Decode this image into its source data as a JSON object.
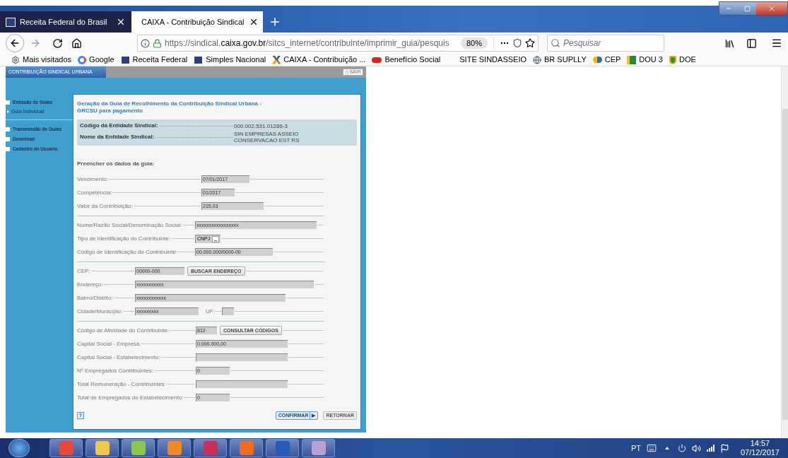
{
  "browser": {
    "tabs": [
      {
        "label": "Receita Federal do Brasil",
        "selected": false
      },
      {
        "label": "CAIXA - Contribuição Sindical",
        "selected": true
      }
    ],
    "address": "https://sindical.**caixa.gov.br**/sitcs_internet/contribuinte/imprimir_guia/pesquis",
    "zoom": "80%",
    "search": {
      "placeholder": "Pesquisar"
    },
    "bookmarks": [
      {
        "label": "Mais visitados",
        "kind": "gear"
      },
      {
        "label": "Google",
        "kind": "google"
      },
      {
        "label": "Receita Federal",
        "kind": "receita"
      },
      {
        "label": "Simples Nacional",
        "kind": "receita"
      },
      {
        "label": "CAIXA - Contribuição ...",
        "kind": "caixa"
      },
      {
        "label": "Benefício Social",
        "kind": "inss"
      },
      {
        "label": "SITE SINDASSEIO",
        "kind": "none"
      },
      {
        "label": "BR SUPLLY",
        "kind": "globe"
      },
      {
        "label": "CEP",
        "kind": "cep"
      },
      {
        "label": "DOU 3",
        "kind": "dou"
      },
      {
        "label": "DOE",
        "kind": "doe"
      }
    ]
  },
  "site": {
    "header_tab": "CONTRIBUIÇÃO SINDICAL URBANA",
    "logout": "SAIR",
    "sidebar": [
      {
        "label": "Emissão de Guias",
        "children": [
          {
            "label": "Guia Individual"
          }
        ]
      },
      {
        "label": "Transmissão de Guias"
      },
      {
        "label": "Download"
      },
      {
        "label": "Cadastro de Usuário"
      }
    ],
    "form": {
      "title": "Geração da Guia de Recolhimento da Contribuição Sindical Urbana - GRCSU para pagamento",
      "entity": [
        {
          "label": "Código da Entidade Sindical:",
          "value": "000.002.531.01286-3"
        },
        {
          "label": "Nome da Entidade Sindical:",
          "value": "SIN EMPRESAS ASSEIO CONSERVACAO EST RS"
        }
      ],
      "section_title": "Preencher os dados da guia:",
      "groups": [
        [
          {
            "kind": "text",
            "label": "Vencimento:",
            "value": "07/01/2017"
          },
          {
            "kind": "text",
            "label": "Competência:",
            "value": "01/2017"
          },
          {
            "kind": "text",
            "label": "Valor da Contribuição:",
            "value": "215,03"
          }
        ],
        [
          {
            "kind": "text",
            "label": "Nome/Razão Social/Denominação Social:",
            "value": "xxxxxxxxxxxxxxxxx"
          },
          {
            "kind": "select",
            "label": "Tipo de Identificação do Contribuinte:",
            "value": "CNPJ"
          },
          {
            "kind": "text",
            "label": "Código de Identificação do Contribuinte:",
            "value": "00.000.000/0000-00"
          }
        ],
        [
          {
            "kind": "button",
            "label": "CEP:",
            "value": "00000-000",
            "button": "BUSCAR ENDEREÇO"
          },
          {
            "kind": "text",
            "label": "Endereço:",
            "value": "xxxxxxxxxxx"
          },
          {
            "kind": "text",
            "label": "Bairro/Distrito:",
            "value": "xxxxxxxxxxxx"
          },
          {
            "kind": "pair",
            "label": "Cidade/Município:",
            "value": "xxxxxxxxx",
            "label2": "UF:"
          }
        ],
        [
          {
            "kind": "button",
            "label": "Código de Atividade do Contribuinte:",
            "value": "812",
            "button": "CONSULTAR CÓDIGOS"
          },
          {
            "kind": "text",
            "label": "Capital Social - Empresa:",
            "value": "0.000.000,00"
          },
          {
            "kind": "text",
            "label": "Capital Social - Estabelecimento:"
          },
          {
            "kind": "text",
            "label": "Nº Empregados Contribuintes:",
            "value": "0"
          },
          {
            "kind": "text",
            "label": "Total Remuneração - Contribuintes:"
          },
          {
            "kind": "text",
            "label": "Total de Empregados do Estabelecimento:",
            "value": "0"
          }
        ]
      ],
      "help": "?",
      "confirm": "CONFIRMAR",
      "confirm_arrow": "▶",
      "back": "RETORNAR"
    }
  },
  "taskbar": {
    "language": "PT",
    "time": "14:57",
    "date": "07/12/2017"
  }
}
